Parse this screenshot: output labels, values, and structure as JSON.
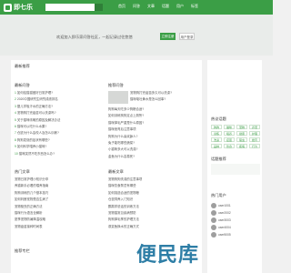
{
  "header": {
    "logo_text": "即七乐",
    "nav": [
      "首页",
      "问答",
      "文章",
      "话题",
      "用户",
      "标签"
    ]
  },
  "banner": {
    "text": "欢迎加入即乐家问答社区，一起记录过往悠悠",
    "primary_btn": "立即注册",
    "secondary_btn": "用户登录"
  },
  "main": {
    "recommend_title": "最新推荐",
    "latest_title": "最新问答",
    "latest_items": [
      "如何给猫猫做好日常护理?",
      "2020中国研究生研究成绩排名",
      "婴儿学吸汗水的正确方法?",
      "宠物狗打完疫苗可以洗澡吗?",
      "关于猫咪咳嗽的原因及解决办法",
      "猫咪可以吃什么水果?",
      "仓鼠为什么会咬人及怎么训练?",
      "狗狗发烧的症状有哪些?",
      "如何科学喂养小猫咪?",
      "猫咪突然不吃东西怎么办?"
    ],
    "recommend_list_title": "推荐问答",
    "recommend_items": [
      "宠物狗打完疫苗多久可以洗澡?",
      "猫咪呕吐黄水是怎么回事?",
      "狗狗每天吃多少狗粮合适?",
      "如何训练狗狗定点上厕所?",
      "猫咪掉毛严重是什么原因?",
      "猫咪绝育后注意事项",
      "狗狗为什么喜欢舔人?",
      "兔子能吃哪些蔬菜?",
      "小猫咪多大可以洗澡?",
      "金鱼为什么容易死?"
    ],
    "hot_title": "热门文章",
    "hot_items": [
      "宠物日常护理小知识分享",
      "养猫新手必看的喂养指南",
      "狗狗训练的几个基本技巧",
      "如何判断宠物是否生病了",
      "宠物驱虫的正确方法",
      "猫咪行为语言全解析",
      "夏季宠物防暑降温攻略",
      "宠物疫苗接种时间表"
    ],
    "new_title": "最新文章",
    "new_items": [
      "宠物狗狗洗澡的注意事项",
      "猫咪饮食禁忌有哪些",
      "如何挑选合适的宠物粮",
      "仓鼠饲养入门知识",
      "鹦鹉学说话的训练方法",
      "宠物猫常见疾病预防",
      "狗狗掉毛季的护理方法",
      "观赏鱼换水的正确方式"
    ],
    "footer_title": "推荐专栏"
  },
  "sidebar": {
    "topic_title": "热议话题",
    "tags": [
      "狗狗",
      "猫咪",
      "宠物",
      "养宠",
      "训练",
      "喂养",
      "健康",
      "护理",
      "洗澡",
      "疫苗",
      "驱虫",
      "绝育",
      "品种",
      "饮食",
      "疾病",
      "行为"
    ],
    "hot_title": "话题推荐",
    "users_title": "热门用户",
    "users": [
      "user1001",
      "user2002",
      "user3003",
      "user4004",
      "user5005"
    ],
    "mini_title": "热门问题"
  },
  "watermark": "便民库"
}
